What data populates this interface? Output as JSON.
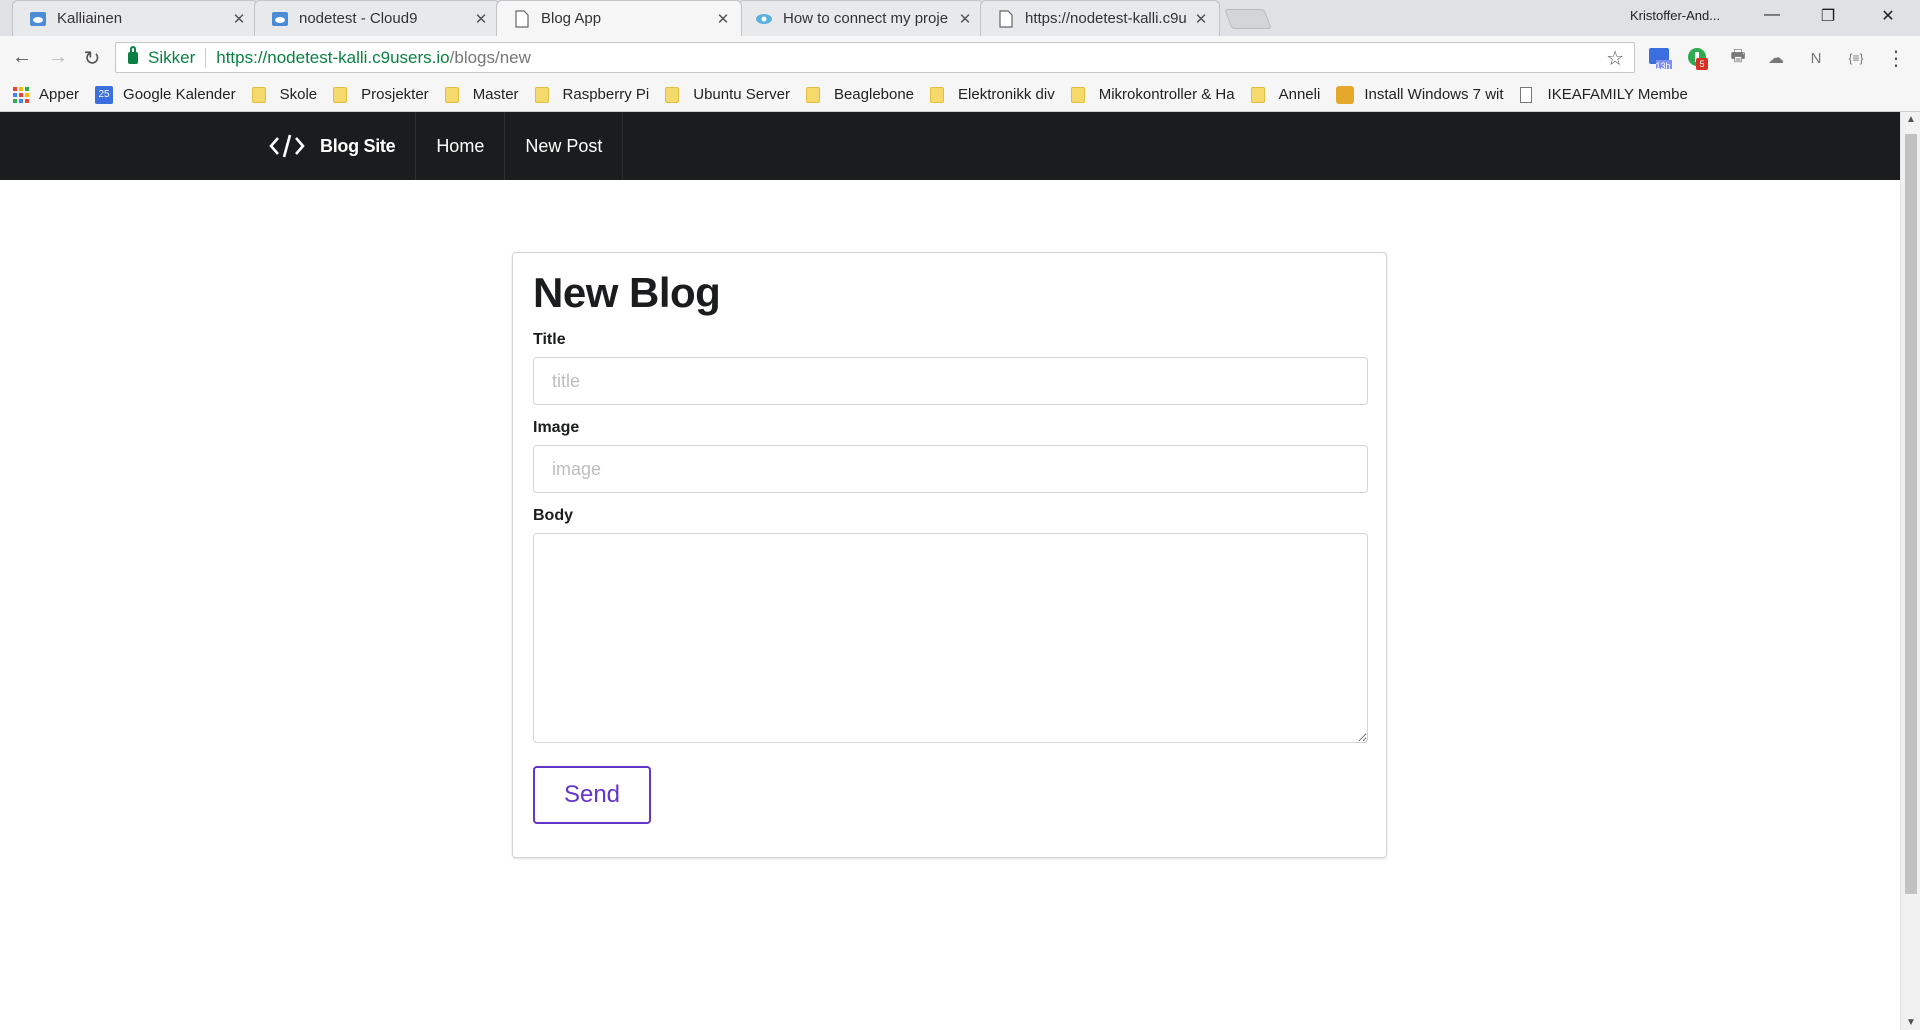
{
  "browser": {
    "tabs": [
      {
        "title": "Kalliainen",
        "icon": "cloud9-icon"
      },
      {
        "title": "nodetest - Cloud9",
        "icon": "cloud9-icon"
      },
      {
        "title": "Blog App",
        "icon": "page-icon",
        "active": true
      },
      {
        "title": "How to connect my proje",
        "icon": "eye-icon"
      },
      {
        "title": "https://nodetest-kalli.c9u",
        "icon": "page-icon"
      }
    ],
    "profile_name": "Kristoffer-And...",
    "address": {
      "secure_label": "Sikker",
      "url_host": "https://nodetest-kalli.c9users.io",
      "url_path": "/blogs/new"
    },
    "extensions": {
      "calendar_badge": "13h",
      "green_badge": "5"
    },
    "bookmarks": [
      {
        "label": "Apper",
        "icon": "apps-grid-icon"
      },
      {
        "label": "Google Kalender",
        "icon": "calendar-icon",
        "icon_text": "25"
      },
      {
        "label": "Skole",
        "icon": "folder-icon"
      },
      {
        "label": "Prosjekter",
        "icon": "folder-icon"
      },
      {
        "label": "Master",
        "icon": "folder-icon"
      },
      {
        "label": "Raspberry Pi",
        "icon": "folder-icon"
      },
      {
        "label": "Ubuntu Server",
        "icon": "folder-icon"
      },
      {
        "label": "Beaglebone",
        "icon": "folder-icon"
      },
      {
        "label": "Elektronikk div",
        "icon": "folder-icon"
      },
      {
        "label": "Mikrokontroller & Ha",
        "icon": "folder-icon"
      },
      {
        "label": "Anneli",
        "icon": "folder-icon"
      },
      {
        "label": "Install Windows 7 wit",
        "icon": "windows-icon"
      },
      {
        "label": "IKEAFAMILY Member",
        "icon": "page-icon"
      }
    ]
  },
  "site": {
    "brand": "Blog Site",
    "nav": {
      "home": "Home",
      "new_post": "New Post"
    },
    "accent_color": "#6435c9"
  },
  "form": {
    "heading": "New Blog",
    "title_label": "Title",
    "title_placeholder": "title",
    "title_value": "",
    "image_label": "Image",
    "image_placeholder": "image",
    "image_value": "",
    "body_label": "Body",
    "body_value": "",
    "submit_label": "Send"
  }
}
